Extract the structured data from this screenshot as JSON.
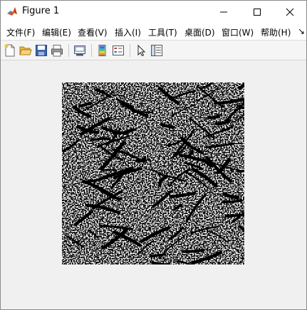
{
  "window": {
    "title": "Figure 1"
  },
  "title_buttons": {
    "minimize_icon": "minimize-icon",
    "maximize_icon": "maximize-icon",
    "close_icon": "close-icon"
  },
  "menu": {
    "items": [
      {
        "label": "文件(F)"
      },
      {
        "label": "编辑(E)"
      },
      {
        "label": "查看(V)"
      },
      {
        "label": "插入(I)"
      },
      {
        "label": "工具(T)"
      },
      {
        "label": "桌面(D)"
      },
      {
        "label": "窗口(W)"
      },
      {
        "label": "帮助(H)"
      }
    ],
    "overflow": "↘"
  },
  "toolbar": {
    "icons": [
      "new-figure-icon",
      "open-file-icon",
      "save-icon",
      "print-icon",
      "link-plot-icon",
      "colorbar-icon",
      "legend-icon",
      "edit-plot-arrow-icon",
      "property-inspector-icon"
    ]
  },
  "colors": {
    "background": "#f0f0f0",
    "titlebar": "#ffffff",
    "image_light": "#ffffff",
    "image_dark": "#000000"
  }
}
